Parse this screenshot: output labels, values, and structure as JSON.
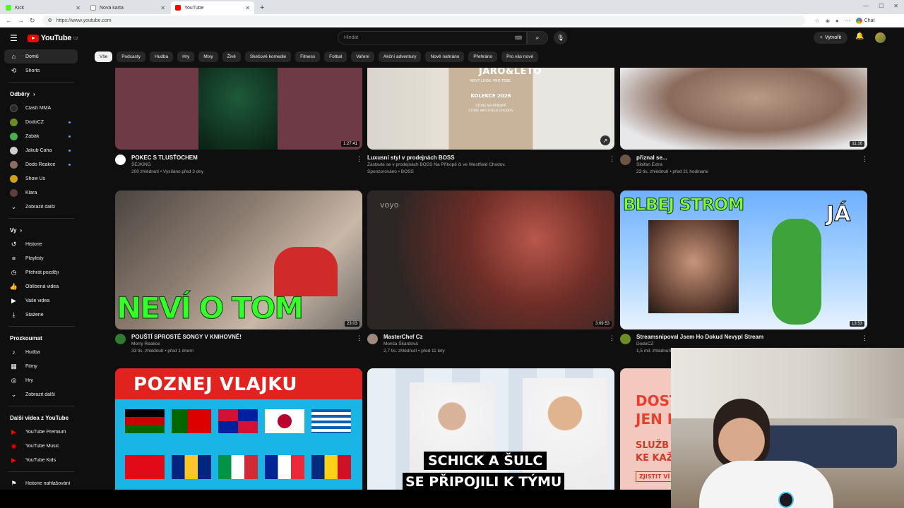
{
  "browser": {
    "tabs": [
      {
        "title": "Kick",
        "favicon_color": "#53fc18",
        "active": false
      },
      {
        "title": "Nová karta",
        "favicon_color": "#8a8f96",
        "active": false
      },
      {
        "title": "YouTube",
        "favicon_color": "#ff0000",
        "active": true
      }
    ],
    "url": "https://www.youtube.com",
    "chat_label": "Chat"
  },
  "header": {
    "logo_text": "YouTube",
    "country_code": "CZ",
    "search_placeholder": "Hledat",
    "create_label": "Vytvořit"
  },
  "sidebar": {
    "main": [
      {
        "label": "Domů",
        "icon": "home-icon",
        "active": true
      },
      {
        "label": "Shorts",
        "icon": "shorts-icon",
        "active": false
      }
    ],
    "subscriptions_title": "Odběry",
    "subscriptions": [
      {
        "label": "Clash MMA",
        "color": "#2a2a2a",
        "live": false
      },
      {
        "label": "DodoCZ",
        "color": "#6b8e23",
        "live": true
      },
      {
        "label": "Žabák",
        "color": "#4caf50",
        "live": true
      },
      {
        "label": "Jakub Caha",
        "color": "#cfcfcf",
        "live": true
      },
      {
        "label": "Dodo Reakce",
        "color": "#8d6e63",
        "live": true
      },
      {
        "label": "Show Us",
        "color": "#d4a017",
        "live": false
      },
      {
        "label": "Klara",
        "color": "#5d4037",
        "live": false
      }
    ],
    "show_more": "Zobrazit další",
    "you_title": "Vy",
    "you": [
      {
        "label": "Historie",
        "icon": "history-icon"
      },
      {
        "label": "Playlisty",
        "icon": "playlists-icon"
      },
      {
        "label": "Přehrát později",
        "icon": "watch-later-icon"
      },
      {
        "label": "Oblíbená videa",
        "icon": "like-icon"
      },
      {
        "label": "Vaše videa",
        "icon": "your-videos-icon"
      },
      {
        "label": "Stažené",
        "icon": "download-icon"
      }
    ],
    "explore_title": "Prozkoumat",
    "explore": [
      {
        "label": "Hudba",
        "icon": "music-icon"
      },
      {
        "label": "Filmy",
        "icon": "movies-icon"
      },
      {
        "label": "Hry",
        "icon": "gaming-icon"
      }
    ],
    "explore_more": "Zobrazit další",
    "more_title": "Další videa z YouTube",
    "more": [
      {
        "label": "YouTube Premium"
      },
      {
        "label": "YouTube Music"
      },
      {
        "label": "YouTube Kids"
      }
    ],
    "report_label": "Historie nahlašování"
  },
  "chips": [
    "Vše",
    "Podcasty",
    "Hudba",
    "Hry",
    "Mixy",
    "Živě",
    "Skečové komedie",
    "Fitness",
    "Fotbal",
    "Vaření",
    "Akční adventury",
    "Nově nahráno",
    "Přehráno",
    "Pro vás nové"
  ],
  "videos_row1": [
    {
      "title": "POKEC S TLUSŤOCHEM",
      "channel": "ŠEJKING",
      "stats": "200 zhlédnutí • Vysíláno před 3 dny",
      "duration": "1:27:41"
    },
    {
      "title": "Luxusní styl v prodejnách BOSS",
      "channel": "Zastavte se v prodejnách BOSS Na Příkopě či ve Westfield Chodov.",
      "stats": "Sponzorováno • BOSS",
      "sponsored_label": "Sponzorováno",
      "ad_line1": "JARO&LETO",
      "ad_line2": "NOVÝ LOOK. PRO TEBE.",
      "ad_line3": "KOLEKCE 2026",
      "ad_line4": "STORE NA PŘÍKOPĚ",
      "ad_line5": "STORE WESTFIELD CHODOV"
    },
    {
      "title": "přiznal se...",
      "channel": "Sibifan Extra",
      "stats": "23 tis. zhlédnutí • před 21 hodinami",
      "duration": "11:16"
    }
  ],
  "videos_row2": [
    {
      "title": "POUŠTÍ SPROSTÉ SONGY V KNIHOVNĚ!",
      "channel": "Morry Reakce",
      "stats": "33 tis. zhlédnutí • před 1 dnem",
      "duration": "23:03",
      "overlay": "NEVÍ O TOM"
    },
    {
      "title": "MasterChef Cz",
      "channel": "Monča Škardová",
      "stats": "2,7 tis. zhlédnutí • před 11 lety",
      "duration": "3:09:53",
      "overlay": "voyo"
    },
    {
      "title": "Streamsnipoval Jsem Ho Dokud Nevypl Stream",
      "channel": "DodoCZ",
      "stats": "1,5 mil. zhlédnutí",
      "duration": "13:53",
      "overlay": "BLBEJ STROM",
      "overlay2": "JÁ"
    }
  ],
  "videos_row3": [
    {
      "overlay": "POZNEJ VLAJKU"
    },
    {
      "overlay": "SCHICK A ŠULC",
      "overlay2": "SE PŘIPOJILI K TÝMU"
    },
    {
      "overlay": "DOST",
      "overlay2": "JEN P",
      "overlay3": "SLUŽB",
      "overlay4": "KE KAŽ",
      "overlay5": "ZJISTIT VÍ"
    }
  ]
}
